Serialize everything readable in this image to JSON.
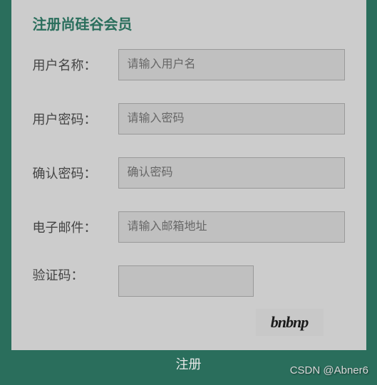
{
  "form": {
    "title": "注册尚硅谷会员",
    "fields": {
      "username": {
        "label": "用户名称：",
        "placeholder": "请输入用户名",
        "value": ""
      },
      "password": {
        "label": "用户密码：",
        "placeholder": "请输入密码",
        "value": ""
      },
      "confirm": {
        "label": "确认密码：",
        "placeholder": "确认密码",
        "value": ""
      },
      "email": {
        "label": "电子邮件：",
        "placeholder": "请输入邮箱地址",
        "value": ""
      },
      "captcha": {
        "label": "验证码：",
        "value": ""
      }
    },
    "captcha_image_text": "bnbnp",
    "submit_label": "注册"
  },
  "watermark": "CSDN @Abner6"
}
